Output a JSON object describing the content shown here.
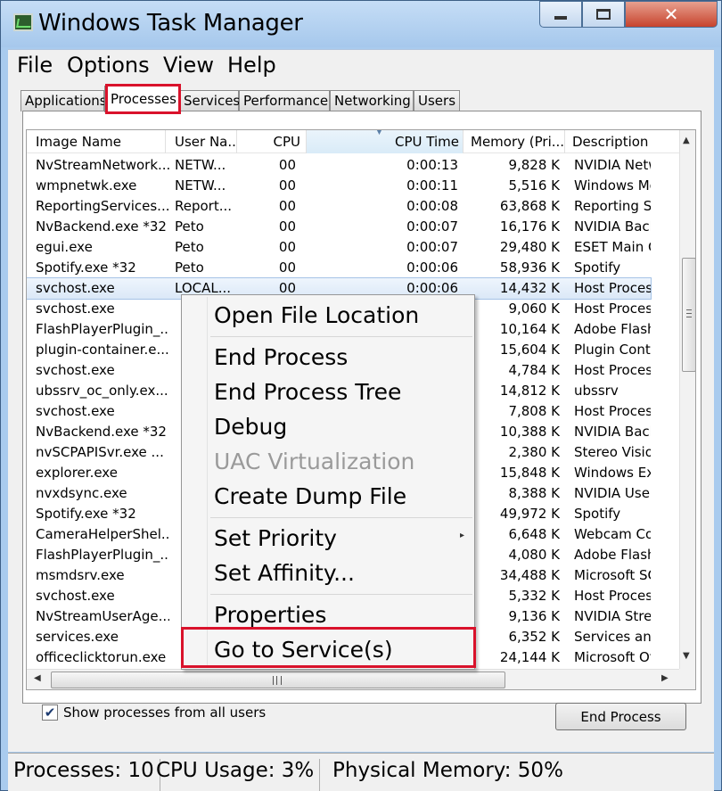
{
  "window": {
    "title": "Windows Task Manager",
    "min_label": "▭",
    "max_label": "▢",
    "close_label": "✕"
  },
  "menubar": [
    "File",
    "Options",
    "View",
    "Help"
  ],
  "tabs": [
    "Applications",
    "Processes",
    "Services",
    "Performance",
    "Networking",
    "Users"
  ],
  "active_tab": "Processes",
  "columns": [
    "Image Name",
    "User Na...",
    "CPU",
    "CPU Time",
    "Memory (Pri...",
    "Description"
  ],
  "sorted_column": "CPU Time",
  "processes": [
    {
      "name": "NvStreamNetwork...",
      "user": "NETW...",
      "cpu": "00",
      "time": "0:00:13",
      "mem": "9,828 K",
      "desc": "NVIDIA Netw"
    },
    {
      "name": "wmpnetwk.exe",
      "user": "NETW...",
      "cpu": "00",
      "time": "0:00:11",
      "mem": "5,516 K",
      "desc": "Windows Me"
    },
    {
      "name": "ReportingServices...",
      "user": "Report...",
      "cpu": "00",
      "time": "0:00:08",
      "mem": "63,868 K",
      "desc": "Reporting Se"
    },
    {
      "name": "NvBackend.exe *32",
      "user": "Peto",
      "cpu": "00",
      "time": "0:00:07",
      "mem": "16,176 K",
      "desc": "NVIDIA Back"
    },
    {
      "name": "egui.exe",
      "user": "Peto",
      "cpu": "00",
      "time": "0:00:07",
      "mem": "29,480 K",
      "desc": "ESET Main G"
    },
    {
      "name": "Spotify.exe *32",
      "user": "Peto",
      "cpu": "00",
      "time": "0:00:06",
      "mem": "58,936 K",
      "desc": "Spotify"
    },
    {
      "name": "svchost.exe",
      "user": "LOCAL...",
      "cpu": "00",
      "time": "0:00:06",
      "mem": "14,432 K",
      "desc": "Host Process"
    },
    {
      "name": "svchost.exe",
      "user": "",
      "cpu": "",
      "time": "",
      "mem": "9,060 K",
      "desc": "Host Process"
    },
    {
      "name": "FlashPlayerPlugin_...",
      "user": "",
      "cpu": "",
      "time": "",
      "mem": "10,164 K",
      "desc": "Adobe Flash"
    },
    {
      "name": "plugin-container.e...",
      "user": "",
      "cpu": "",
      "time": "",
      "mem": "15,604 K",
      "desc": "Plugin Conta"
    },
    {
      "name": "svchost.exe",
      "user": "",
      "cpu": "",
      "time": "",
      "mem": "4,784 K",
      "desc": "Host Process"
    },
    {
      "name": "ubssrv_oc_only.ex...",
      "user": "",
      "cpu": "",
      "time": "",
      "mem": "14,812 K",
      "desc": "ubssrv"
    },
    {
      "name": "svchost.exe",
      "user": "",
      "cpu": "",
      "time": "",
      "mem": "7,808 K",
      "desc": "Host Process"
    },
    {
      "name": "NvBackend.exe *32",
      "user": "",
      "cpu": "",
      "time": "",
      "mem": "10,388 K",
      "desc": "NVIDIA Back"
    },
    {
      "name": "nvSCPAPISvr.exe ...",
      "user": "",
      "cpu": "",
      "time": "",
      "mem": "2,380 K",
      "desc": "Stereo Vision"
    },
    {
      "name": "explorer.exe",
      "user": "",
      "cpu": "",
      "time": "",
      "mem": "15,848 K",
      "desc": "Windows Ex"
    },
    {
      "name": "nvxdsync.exe",
      "user": "",
      "cpu": "",
      "time": "",
      "mem": "8,388 K",
      "desc": "NVIDIA Use"
    },
    {
      "name": "Spotify.exe *32",
      "user": "",
      "cpu": "",
      "time": "",
      "mem": "49,972 K",
      "desc": "Spotify"
    },
    {
      "name": "CameraHelperShel...",
      "user": "",
      "cpu": "",
      "time": "",
      "mem": "6,648 K",
      "desc": "Webcam Co"
    },
    {
      "name": "FlashPlayerPlugin_...",
      "user": "",
      "cpu": "",
      "time": "",
      "mem": "4,080 K",
      "desc": "Adobe Flash"
    },
    {
      "name": "msmdsrv.exe",
      "user": "",
      "cpu": "",
      "time": "",
      "mem": "34,488 K",
      "desc": "Microsoft SQ"
    },
    {
      "name": "svchost.exe",
      "user": "",
      "cpu": "",
      "time": "",
      "mem": "5,332 K",
      "desc": "Host Process"
    },
    {
      "name": "NvStreamUserAge...",
      "user": "",
      "cpu": "",
      "time": "",
      "mem": "9,136 K",
      "desc": "NVIDIA Stre"
    },
    {
      "name": "services.exe",
      "user": "",
      "cpu": "",
      "time": "",
      "mem": "6,352 K",
      "desc": "Services and"
    },
    {
      "name": "officeclicktorun.exe",
      "user": "",
      "cpu": "",
      "time": "",
      "mem": "24,144 K",
      "desc": "Microsoft Of"
    }
  ],
  "context_menu": {
    "open_file_location": "Open File Location",
    "end_process": "End Process",
    "end_process_tree": "End Process Tree",
    "debug": "Debug",
    "uac_virtualization": "UAC Virtualization",
    "create_dump_file": "Create Dump File",
    "set_priority": "Set Priority",
    "set_affinity": "Set Affinity...",
    "properties": "Properties",
    "go_to_services": "Go to Service(s)"
  },
  "show_all_users": {
    "checked": true,
    "label": "Show processes from all users",
    "mark": "✔"
  },
  "end_process_button": "End Process",
  "statusbar": {
    "processes": "Processes: 10",
    "cpu": "CPU Usage: 3%",
    "memory": "Physical Memory: 50%"
  },
  "colors": {
    "highlight": "#d9122b",
    "title_bar": "#a9cbee",
    "selection": "#dbe8f7"
  }
}
